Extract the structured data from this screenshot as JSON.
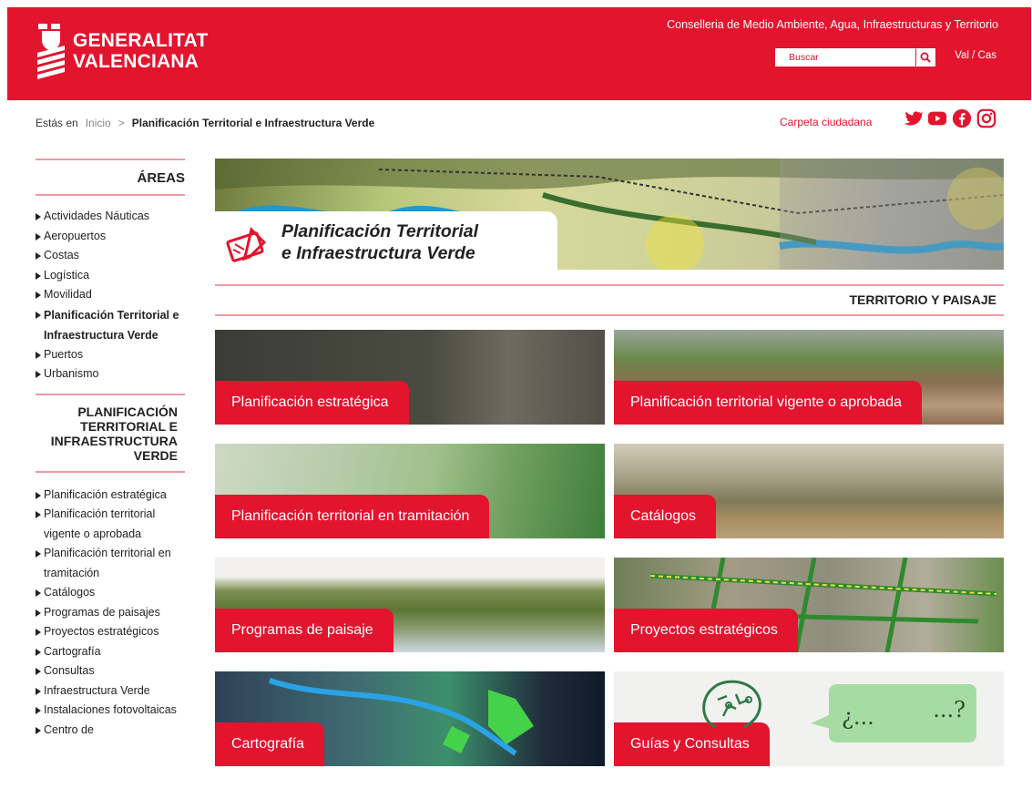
{
  "header": {
    "logo_text": "GENERALITAT\nVALENCIANA",
    "department": "Conselleria de Medio Ambiente, Agua, Infraestructuras y Territorio",
    "search_placeholder": "Buscar",
    "lang": "Val / Cas"
  },
  "breadcrumb": {
    "prefix": "Estás en",
    "home": "Inicio",
    "separator": ">",
    "current": "Planificación Territorial e Infraestructura Verde",
    "carpeta": "Carpeta ciudadana"
  },
  "social": [
    "twitter-icon",
    "youtube-icon",
    "facebook-icon",
    "instagram-icon"
  ],
  "sidebar": {
    "areas_title": "ÁREAS",
    "areas": [
      "Actividades Náuticas",
      "Aeropuertos",
      "Costas",
      "Logística",
      "Movilidad",
      "Planificación Territorial e Infraestructura Verde",
      "Puertos",
      "Urbanismo"
    ],
    "section_title": "PLANIFICACIÓN TERRITORIAL E INFRAESTRUCTURA VERDE",
    "section_items": [
      "Planificación estratégica",
      "Planificación territorial vigente o aprobada",
      "Planificación territorial en tramitación",
      "Catálogos",
      "Programas de paisajes",
      "Proyectos estratégicos",
      "Cartografía",
      "Consultas",
      "Infraestructura Verde",
      "Instalaciones fotovoltaicas",
      "Centro de"
    ]
  },
  "banner": {
    "title": "Planificación Territorial\ne Infraestructura Verde"
  },
  "section": {
    "title": "TERRITORIO Y PAISAJE"
  },
  "cards": [
    "Planificación estratégica",
    "Planificación territorial vigente o aprobada",
    "Planificación territorial en tramitación",
    "Catálogos",
    "Programas de paisaje",
    "Proyectos estratégicos",
    "Cartografía",
    "Guías y Consultas"
  ],
  "bubble": {
    "left": "¿...",
    "right": "...?"
  },
  "colors": {
    "brand_red": "#e3142d",
    "rule_pink": "#f29aa6"
  }
}
